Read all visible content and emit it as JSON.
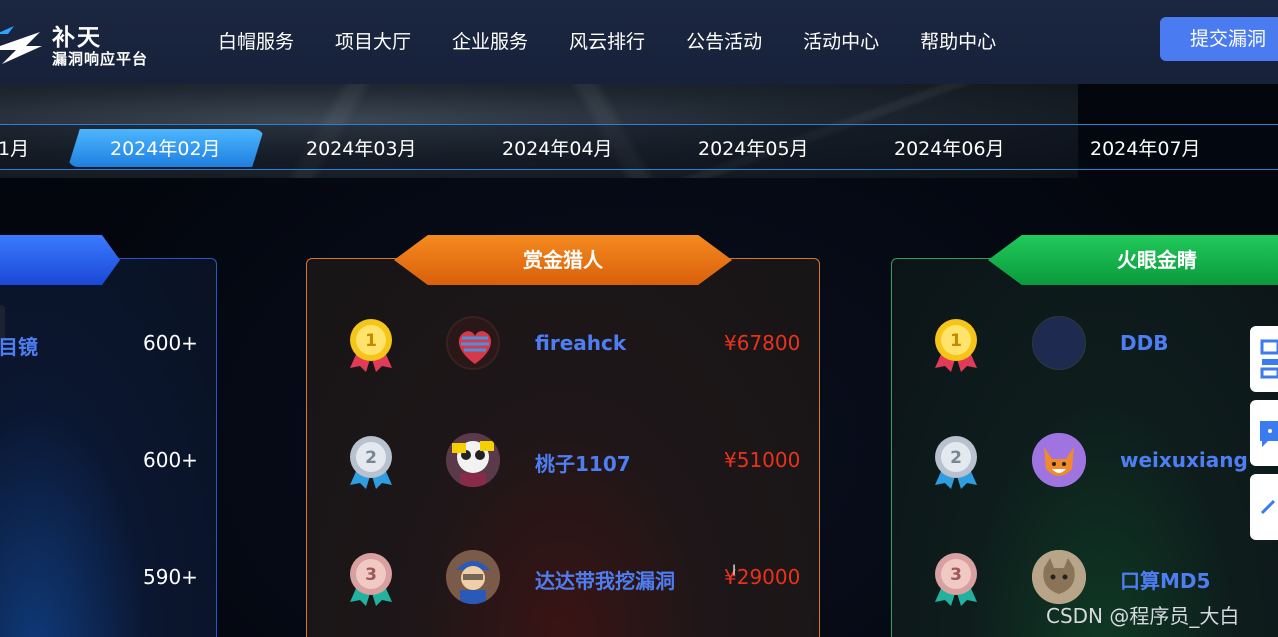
{
  "header": {
    "logo_title": "补天",
    "logo_subtitle": "漏洞响应平台",
    "nav": [
      "白帽服务",
      "项目大厅",
      "企业服务",
      "风云排行",
      "公告活动",
      "活动中心",
      "帮助中心"
    ],
    "submit_label": "提交漏洞"
  },
  "months": {
    "items": [
      "1月",
      "2024年02月",
      "2024年03月",
      "2024年04月",
      "2024年05月",
      "2024年06月",
      "2024年07月"
    ],
    "active_index": 1
  },
  "left_card": {
    "rows": [
      {
        "name": "目镜",
        "count": "600+"
      },
      {
        "name": "",
        "count": "600+"
      },
      {
        "name": "",
        "count": "590+"
      }
    ]
  },
  "bounty_card": {
    "title": "赏金猎人",
    "rows": [
      {
        "rank": "1",
        "name": "fireahck",
        "amount": "¥67800"
      },
      {
        "rank": "2",
        "name": "桃子1107",
        "amount": "¥51000"
      },
      {
        "rank": "3",
        "name": "达达带我挖漏洞",
        "amount": "¥29000"
      }
    ]
  },
  "eye_card": {
    "title": "火眼金睛",
    "rows": [
      {
        "rank": "1",
        "name": "DDB"
      },
      {
        "rank": "2",
        "name": "weixuxiang"
      },
      {
        "rank": "3",
        "name": "口算MD5"
      }
    ]
  },
  "side_tools": [
    "qrcode-icon",
    "chat-icon",
    "back-to-top-icon"
  ],
  "watermark": "CSDN @程序员_大白",
  "colors": {
    "header_bg": "#1b2640",
    "accent_blue": "#4b7bf0",
    "gold_ribbon": "#f58a1f",
    "green_ribbon": "#21c95b",
    "amount_red": "#e8321e",
    "name_blue": "#4f7df2"
  }
}
